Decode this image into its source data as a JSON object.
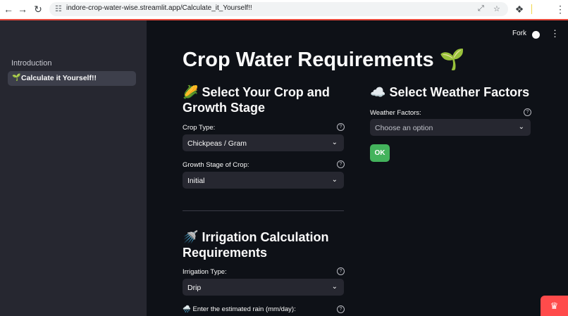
{
  "browser": {
    "url": "indore-crop-water-wise.streamlit.app/Calculate_it_Yourself!!",
    "back_icon": "←",
    "forward_icon": "→",
    "reload_icon": "↻",
    "site_info_icon": "☷",
    "install_icon": "⤢",
    "star_icon": "☆",
    "extensions_icon": "❖",
    "menu_icon": "⋮"
  },
  "sidebar": {
    "items": [
      {
        "label": "Introduction",
        "icon": ""
      },
      {
        "label": "Calculate it Yourself!!",
        "icon": "🌱"
      }
    ]
  },
  "header": {
    "fork_label": "Fork",
    "github_icon": "●",
    "menu_icon": "⋮"
  },
  "main": {
    "title": "Crop Water Requirements",
    "title_emoji": "🌱",
    "crop_section": {
      "heading_emoji": "🌽",
      "heading": "Select Your Crop and Growth Stage",
      "crop_type_label": "Crop Type:",
      "crop_type_value": "Chickpeas / Gram",
      "growth_stage_label": "Growth Stage of Crop:",
      "growth_stage_value": "Initial"
    },
    "weather_section": {
      "heading_emoji": "☁️",
      "heading": "Select Weather Factors",
      "weather_label": "Weather Factors:",
      "weather_placeholder": "Choose an option",
      "ok_label": "OK"
    },
    "irrigation_section": {
      "heading_emoji": "🚿",
      "heading": "Irrigation Calculation Requirements",
      "irrigation_type_label": "Irrigation Type:",
      "irrigation_type_value": "Drip",
      "rain_emoji": "🌧️",
      "rain_label": "Enter the estimated rain (mm/day):"
    },
    "help_icon": "?",
    "chevron_icon": "⌄"
  },
  "fab_icon": "♛"
}
